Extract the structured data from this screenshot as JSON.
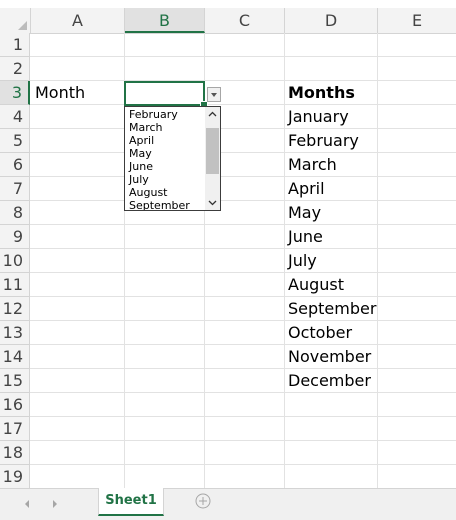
{
  "columns": [
    "A",
    "B",
    "C",
    "D",
    "E"
  ],
  "rows": [
    "1",
    "2",
    "3",
    "4",
    "5",
    "6",
    "7",
    "8",
    "9",
    "10",
    "11",
    "12",
    "13",
    "14",
    "15",
    "16",
    "17",
    "18",
    "19"
  ],
  "selected_column": "B",
  "selected_row": "3",
  "cells": {
    "A3": "Month",
    "D3": "Months",
    "D4": "January",
    "D5": "February",
    "D6": "March",
    "D7": "April",
    "D8": "May",
    "D9": "June",
    "D10": "July",
    "D11": "August",
    "D12": "September",
    "D13": "October",
    "D14": "November",
    "D15": "December"
  },
  "dropdown": {
    "visible_options": [
      "February",
      "March",
      "April",
      "May",
      "June",
      "July",
      "August",
      "September"
    ]
  },
  "sheet_tabs": [
    "Sheet1"
  ],
  "active_sheet": "Sheet1",
  "colors": {
    "accent": "#217346",
    "header_bg": "#f3f3f3",
    "gridline": "#e2e2e2"
  },
  "icons": [
    "select-all-corner-icon",
    "dropdown-arrow-icon",
    "scroll-up-icon",
    "scroll-down-icon",
    "tab-prev-icon",
    "tab-next-icon",
    "add-sheet-icon"
  ]
}
